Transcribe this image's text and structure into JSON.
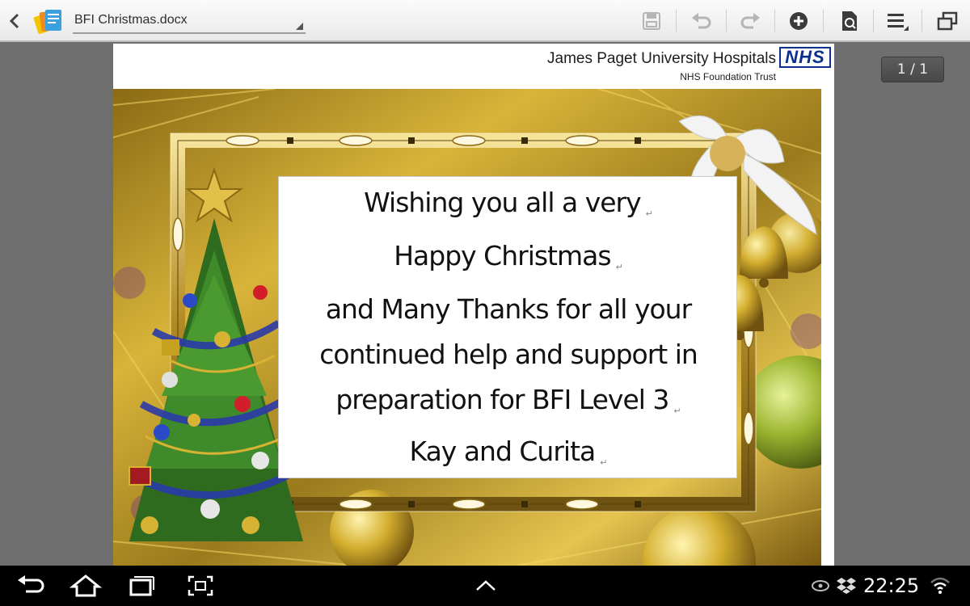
{
  "toolbar": {
    "document_name": "BFI Christmas.docx",
    "icons": [
      "back-icon",
      "app-icon",
      "save-icon",
      "undo-icon",
      "redo-icon",
      "insert-icon",
      "page-view-icon",
      "menu-icon",
      "window-icon"
    ]
  },
  "letterhead": {
    "organisation": "James Paget University Hospitals",
    "subtitle": "NHS Foundation Trust",
    "logo_text": "NHS"
  },
  "card": {
    "lines": [
      "Wishing you all a very",
      "Happy Christmas",
      "and Many Thanks for all your",
      "continued help and support in",
      "preparation for BFI Level 3",
      "Kay and Curita"
    ]
  },
  "viewer": {
    "page_indicator": "1 / 1"
  },
  "system_bar": {
    "clock": "22:25",
    "icons": [
      "back-nav-icon",
      "home-icon",
      "recent-apps-icon",
      "screenshot-icon",
      "up-chevron-icon",
      "usb-debug-icon",
      "dropbox-icon",
      "wifi-icon"
    ]
  },
  "colors": {
    "nhs_blue": "#0b2f8c",
    "gold": "#c9a227",
    "tree_green": "#2f6b1f"
  }
}
